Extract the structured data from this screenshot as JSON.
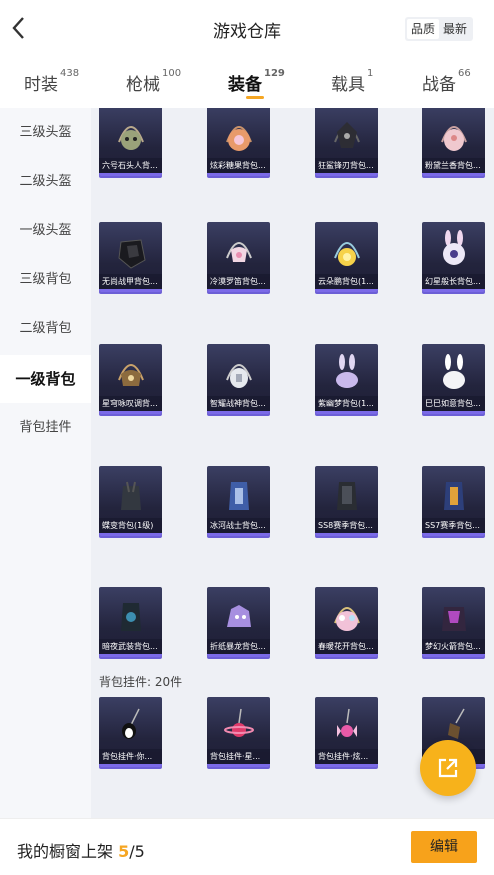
{
  "header": {
    "title": "游戏仓库",
    "sort_options": [
      "品质",
      "最新"
    ]
  },
  "tabs": [
    {
      "label": "时装",
      "count": "438"
    },
    {
      "label": "枪械",
      "count": "100"
    },
    {
      "label": "装备",
      "count": "129"
    },
    {
      "label": "载具",
      "count": "1"
    },
    {
      "label": "战备",
      "count": "66"
    }
  ],
  "sidebar": {
    "items": [
      "三级头盔",
      "二级头盔",
      "一级头盔",
      "三级背包",
      "二级背包",
      "一级背包",
      "背包挂件"
    ],
    "active_index": 5
  },
  "grid": {
    "items": [
      "六号石头人背...",
      "炫彩糖果背包...",
      "狂鲨锋刃背包...",
      "粉黛兰香背包...",
      "无尚战甲背包...",
      "冷漠罗笛背包...",
      "云朵鹏背包(1...",
      "幻星般长背包...",
      "星穹咏叹调背...",
      "智耀战神背包...",
      "紫幽梦背包(1...",
      "巳巳如意背包...",
      "蝶变背包(1级)",
      "冰河战士背包...",
      "SS8赛季背包...",
      "SS7赛季背包...",
      "暗夜武装背包...",
      "折纸暴龙背包...",
      "春暖花开背包...",
      "梦幻火箭背包..."
    ],
    "section_label": "背包挂件: 20件",
    "pendants": [
      "背包挂件·你...",
      "背包挂件·星...",
      "背包挂件·炫...",
      ""
    ]
  },
  "bottom": {
    "text": "我的橱窗上架",
    "current": "5",
    "total": "/5",
    "edit_label": "编辑"
  },
  "colors": {
    "accent": "#f7a21b",
    "card_bg": "#2a2b45",
    "card_bar": "#7b6ae8",
    "content_bg": "#eef0f5"
  },
  "icons": {
    "back": "chevron-left-icon",
    "fab": "share-external-icon"
  }
}
